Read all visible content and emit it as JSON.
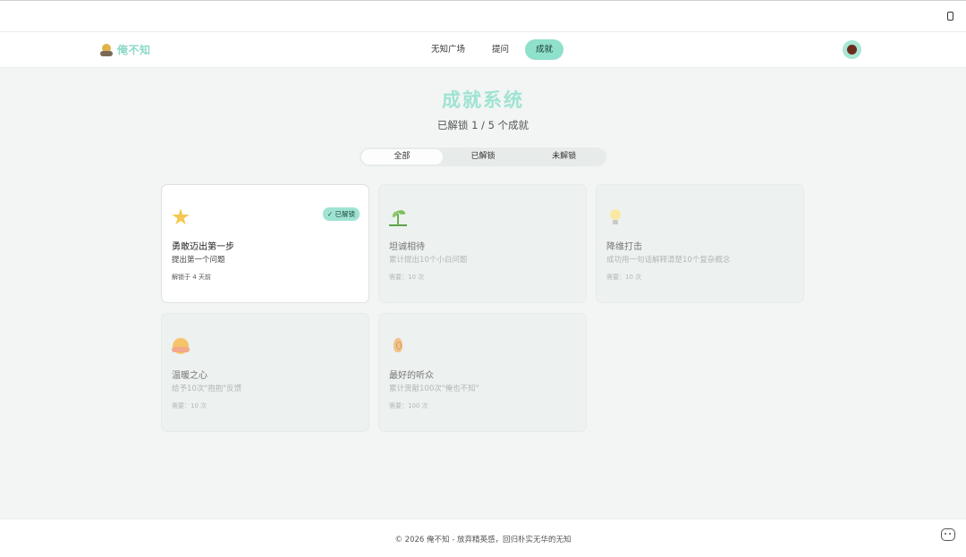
{
  "nav": {
    "brand": "俺不知",
    "items": [
      {
        "label": "无知广场",
        "active": false
      },
      {
        "label": "提问",
        "active": false
      },
      {
        "label": "成就",
        "active": true
      }
    ]
  },
  "header": {
    "title": "成就系统",
    "subtitle": "已解锁 1 / 5 个成就"
  },
  "tabs": [
    {
      "label": "全部",
      "active": true
    },
    {
      "label": "已解锁",
      "active": false
    },
    {
      "label": "未解锁",
      "active": false
    }
  ],
  "achievements": [
    {
      "icon": "star-icon",
      "title": "勇敢迈出第一步",
      "desc": "提出第一个问题",
      "meta": "解锁于 4 天前",
      "unlocked": true,
      "badge": "✓ 已解锁"
    },
    {
      "icon": "seedling-icon",
      "title": "坦诚相待",
      "desc": "累计提出10个小白问题",
      "meta": "需要：10 次",
      "unlocked": false
    },
    {
      "icon": "lightbulb-icon",
      "title": "降维打击",
      "desc": "成功用一句话解释清楚10个复杂概念",
      "meta": "需要：10 次",
      "unlocked": false
    },
    {
      "icon": "hugging-face-icon",
      "title": "温暖之心",
      "desc": "给予10次\"抱抱\"反馈",
      "meta": "需要：10 次",
      "unlocked": false
    },
    {
      "icon": "ear-icon",
      "title": "最好的听众",
      "desc": "累计贡献100次\"俺也不知\"",
      "meta": "需要：100 次",
      "unlocked": false
    }
  ],
  "footer": {
    "text": "© 2026 俺不知 - 放弃精英感，回归朴实无华的无知"
  },
  "colors": {
    "accent": "#8fe0cc",
    "title": "#9fe3d3",
    "background": "#f2f5f3"
  }
}
